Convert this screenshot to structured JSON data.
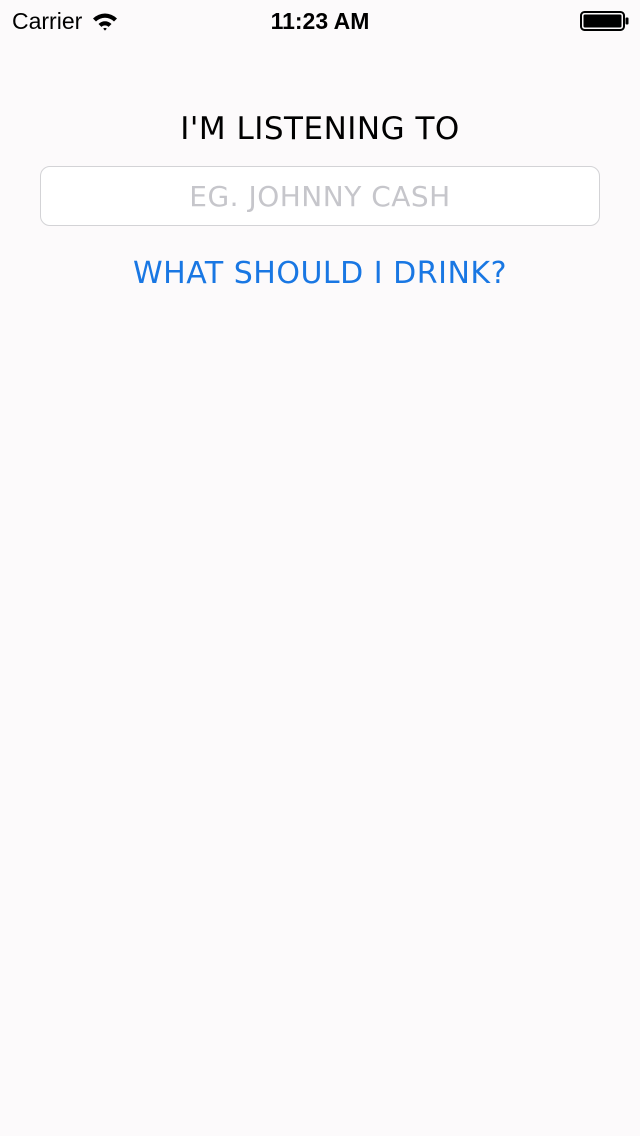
{
  "status_bar": {
    "carrier": "Carrier",
    "time": "11:23 AM",
    "wifi_icon": "wifi-icon",
    "battery_icon": "battery-icon"
  },
  "main": {
    "heading": "I'M LISTENING TO",
    "artist_input": {
      "value": "",
      "placeholder": "EG. JOHNNY CASH"
    },
    "drink_button_label": "WHAT SHOULD I DRINK?"
  },
  "colors": {
    "background": "#fcfafb",
    "accent": "#1977e3",
    "placeholder": "#c6c6cb",
    "input_border": "#d3d3d6"
  }
}
